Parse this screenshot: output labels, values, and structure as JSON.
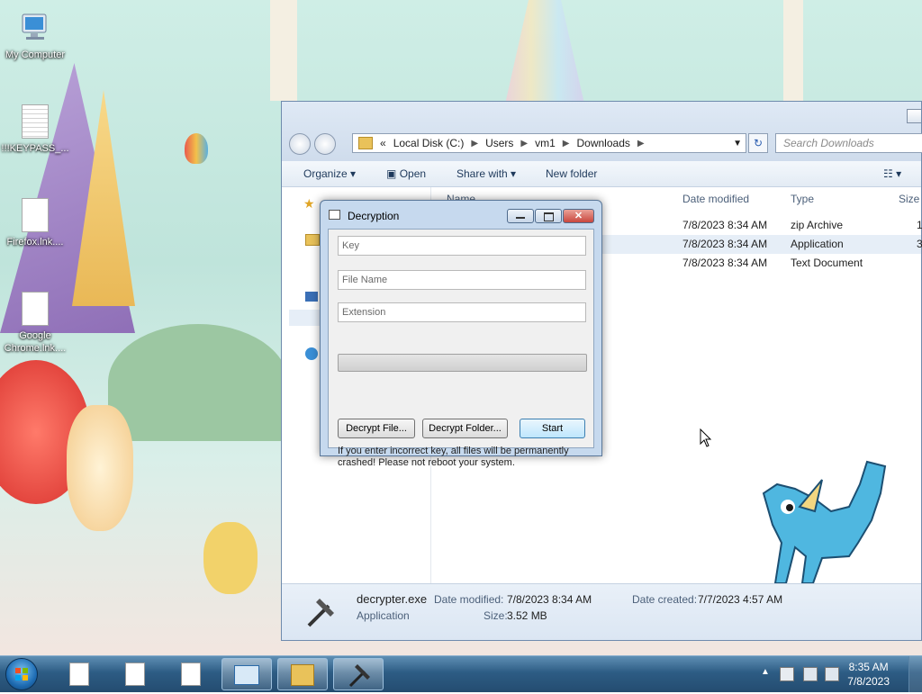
{
  "desktop": {
    "icons": [
      {
        "label": "My Computer",
        "kind": "computer-icon"
      },
      {
        "label": "!!!KEYPASS_...",
        "kind": "text-file-icon"
      },
      {
        "label": "Firefox.lnk....",
        "kind": "file-icon"
      },
      {
        "label": "Google Chrome.lnk....",
        "kind": "file-icon"
      }
    ]
  },
  "explorer": {
    "breadcrumb": {
      "prefix": "«",
      "items": [
        "Local Disk (C:)",
        "Users",
        "vm1",
        "Downloads"
      ]
    },
    "search_placeholder": "Search Downloads",
    "toolbar": {
      "organize": "Organize",
      "open": "Open",
      "share_with": "Share with",
      "new_folder": "New folder"
    },
    "columns": {
      "name": "Name",
      "date_modified": "Date modified",
      "type": "Type",
      "size": "Size"
    },
    "files": [
      {
        "date": "7/8/2023 8:34 AM",
        "type": "zip Archive",
        "size": "1"
      },
      {
        "date": "7/8/2023 8:34 AM",
        "type": "Application",
        "size": "3"
      },
      {
        "date": "7/8/2023 8:34 AM",
        "type": "Text Document",
        "size": ""
      }
    ],
    "details": {
      "name": "decrypter.exe",
      "kind": "Application",
      "date_modified_label": "Date modified:",
      "date_modified": "7/8/2023 8:34 AM",
      "date_created_label": "Date created:",
      "date_created": "7/7/2023 4:57 AM",
      "size_label": "Size:",
      "size": "3.52 MB"
    }
  },
  "dialog": {
    "title": "Decryption",
    "key_placeholder": "Key",
    "file_name_placeholder": "File Name",
    "extension_placeholder": "Extension",
    "progress": 0,
    "buttons": {
      "decrypt_file": "Decrypt File...",
      "decrypt_folder": "Decrypt Folder...",
      "start": "Start"
    },
    "warning": "If you enter incorrect key, all files will be permanently crashed! Please not reboot your system."
  },
  "taskbar": {
    "time": "8:35 AM",
    "date": "7/8/2023"
  },
  "colors": {
    "taskbar": "#2d5c84",
    "dialog_frame": "#c6d9ee",
    "close_button": "#c9463d",
    "progress_fill": "#3bbf3b"
  }
}
